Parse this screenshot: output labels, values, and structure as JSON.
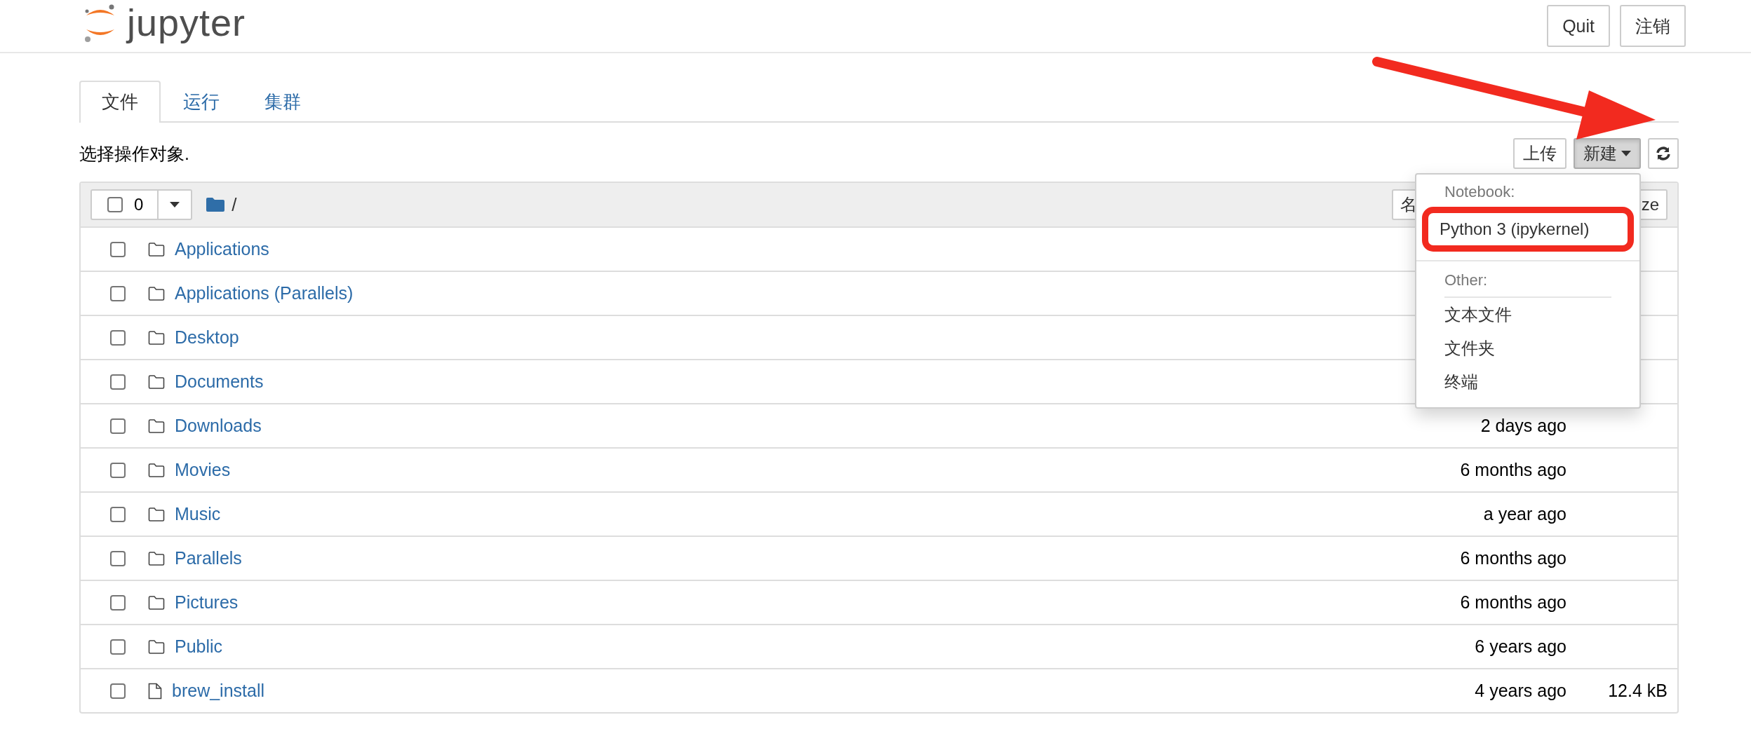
{
  "header": {
    "logo_text": "jupyter",
    "buttons": [
      "Quit",
      "注销"
    ]
  },
  "tabs": [
    {
      "label": "文件",
      "selected": true
    },
    {
      "label": "运行",
      "selected": false
    },
    {
      "label": "集群",
      "selected": false
    }
  ],
  "toolbar": {
    "prompt": "选择操作对象.",
    "upload": "上传",
    "new": "新建"
  },
  "list_header": {
    "select_count": "0",
    "checked": false,
    "path": "/",
    "sort_name": "名",
    "sort_size": "ze"
  },
  "new_menu": [
    {
      "kind": "header",
      "label": "Notebook:"
    },
    {
      "kind": "item",
      "label": "Python 3 (ipykernel)",
      "highlighted": true
    },
    {
      "kind": "header",
      "label": "Other:"
    },
    {
      "kind": "item",
      "label": "文本文件",
      "highlighted": false
    },
    {
      "kind": "item",
      "label": "文件夹",
      "highlighted": false
    },
    {
      "kind": "item",
      "label": "终端",
      "highlighted": false
    }
  ],
  "rows": [
    {
      "kind": "folder",
      "name": "Applications",
      "modified": "",
      "size": "",
      "checked": false
    },
    {
      "kind": "folder",
      "name": "Applications (Parallels)",
      "modified": "",
      "size": "",
      "checked": false
    },
    {
      "kind": "folder",
      "name": "Desktop",
      "modified": "",
      "size": "",
      "checked": false
    },
    {
      "kind": "folder",
      "name": "Documents",
      "modified": "",
      "size": "",
      "checked": false
    },
    {
      "kind": "folder",
      "name": "Downloads",
      "modified": "2 days ago",
      "size": "",
      "checked": false
    },
    {
      "kind": "folder",
      "name": "Movies",
      "modified": "6 months ago",
      "size": "",
      "checked": false
    },
    {
      "kind": "folder",
      "name": "Music",
      "modified": "a year ago",
      "size": "",
      "checked": false
    },
    {
      "kind": "folder",
      "name": "Parallels",
      "modified": "6 months ago",
      "size": "",
      "checked": false
    },
    {
      "kind": "folder",
      "name": "Pictures",
      "modified": "6 months ago",
      "size": "",
      "checked": false
    },
    {
      "kind": "folder",
      "name": "Public",
      "modified": "6 years ago",
      "size": "",
      "checked": false
    },
    {
      "kind": "file",
      "name": "brew_install",
      "modified": "4 years ago",
      "size": "12.4 kB",
      "checked": false
    }
  ],
  "annotation": {
    "arrow": true
  }
}
